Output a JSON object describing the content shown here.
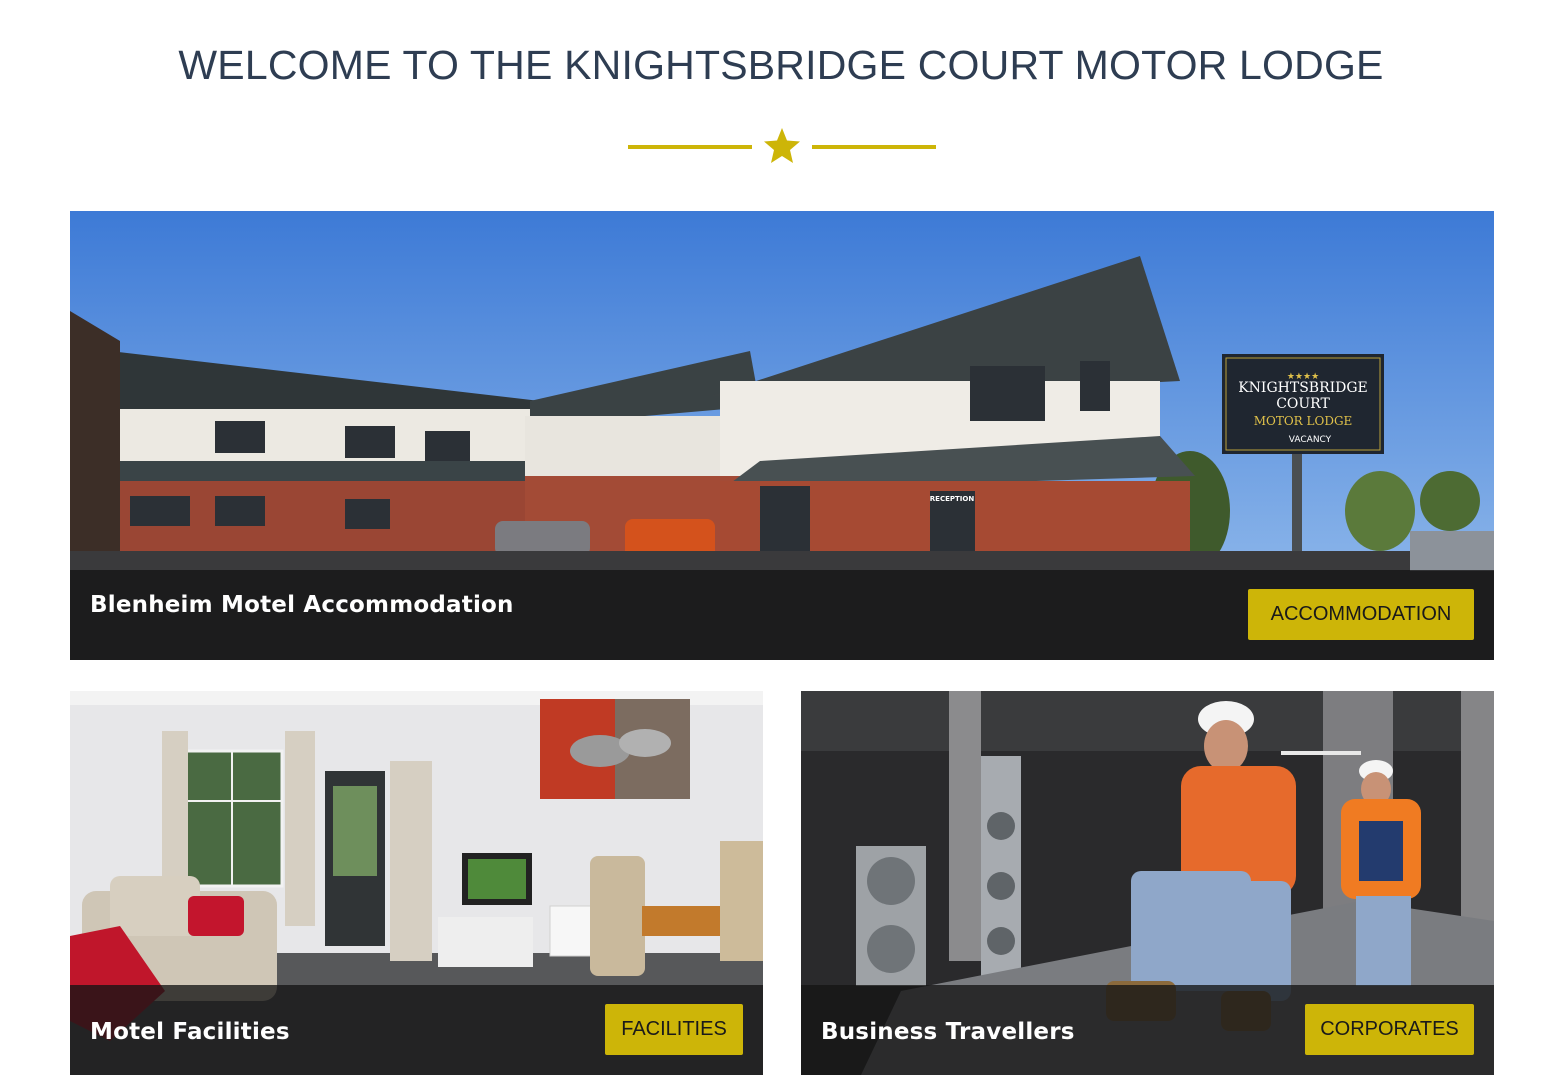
{
  "header": {
    "title": "WELCOME TO THE KNIGHTSBRIDGE COURT MOTOR LODGE",
    "divider_icon": "star-icon",
    "accent_color": "#cdb508",
    "title_color": "#2e3d52"
  },
  "cards": [
    {
      "image": "motel-exterior-photo",
      "label": "Blenheim Motel Accommodation",
      "button": "ACCOMMODATION",
      "sign": {
        "line1": "KNIGHTSBRIDGE",
        "line2": "COURT",
        "line3": "MOTOR LODGE",
        "line4": "VACANCY",
        "stars": "★★★★"
      },
      "reception_sign": "RECEPTION"
    },
    {
      "image": "motel-room-interior-photo",
      "label": "Motel Facilities",
      "button": "FACILITIES"
    },
    {
      "image": "workers-warehouse-photo",
      "label": "Business Travellers",
      "button": "CORPORATES"
    }
  ]
}
